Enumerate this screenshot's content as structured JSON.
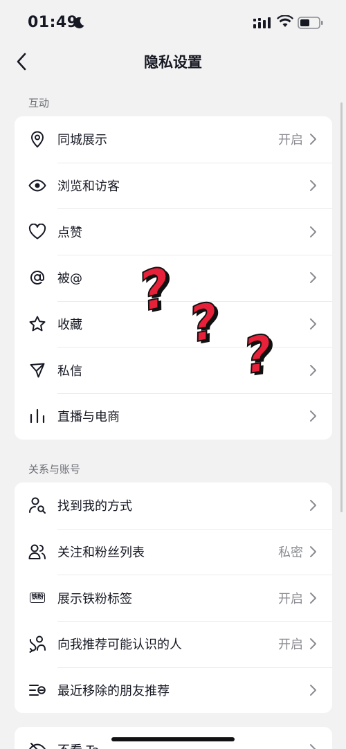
{
  "status_bar": {
    "time": "01:49"
  },
  "nav": {
    "title": "隐私设置"
  },
  "sections": [
    {
      "header": "互动",
      "items": [
        {
          "label": "同城展示",
          "value": "开启",
          "icon": "location-pin-icon"
        },
        {
          "label": "浏览和访客",
          "value": "",
          "icon": "eye-icon"
        },
        {
          "label": "点赞",
          "value": "",
          "icon": "heart-icon"
        },
        {
          "label": "被@",
          "value": "",
          "icon": "at-sign-icon"
        },
        {
          "label": "收藏",
          "value": "",
          "icon": "star-icon"
        },
        {
          "label": "私信",
          "value": "",
          "icon": "paper-plane-icon"
        },
        {
          "label": "直播与电商",
          "value": "",
          "icon": "bar-chart-icon"
        }
      ]
    },
    {
      "header": "关系与账号",
      "items": [
        {
          "label": "找到我的方式",
          "value": "",
          "icon": "person-search-icon"
        },
        {
          "label": "关注和粉丝列表",
          "value": "私密",
          "icon": "people-icon"
        },
        {
          "label": "展示铁粉标签",
          "value": "开启",
          "icon": "fan-badge-icon",
          "badge": "铁粉"
        },
        {
          "label": "向我推荐可能认识的人",
          "value": "开启",
          "icon": "person-link-icon"
        },
        {
          "label": "最近移除的朋友推荐",
          "value": "",
          "icon": "removed-list-icon"
        }
      ]
    },
    {
      "header": "",
      "items": [
        {
          "label": "不看 Ta",
          "value": "",
          "icon": "eye-off-icon"
        }
      ]
    }
  ],
  "colors": {
    "background": "#f2f2f2",
    "card": "#ffffff",
    "text": "#161823",
    "secondary": "#8a8b91",
    "question_mark": "#e8213a"
  }
}
